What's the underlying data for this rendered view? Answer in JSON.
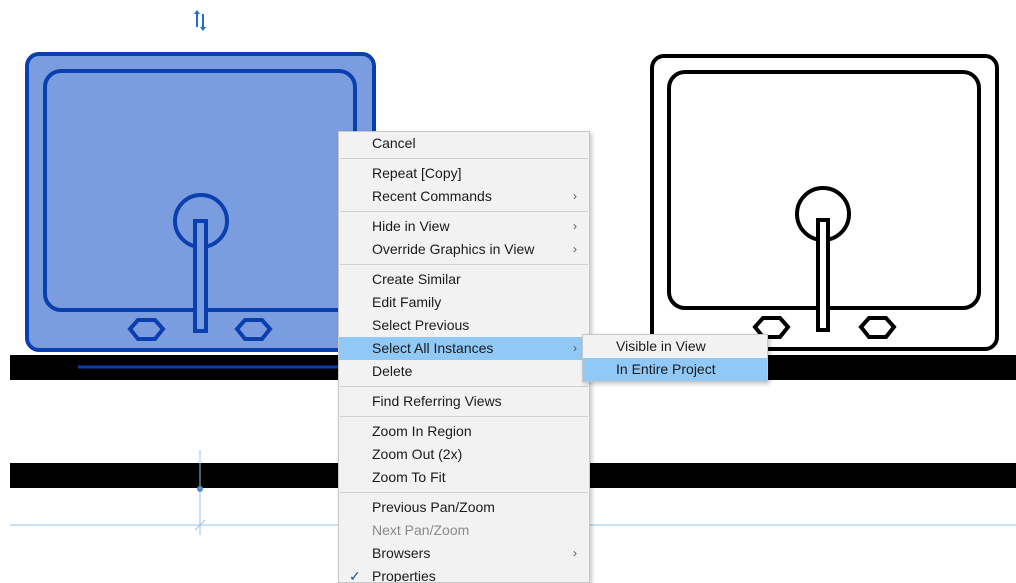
{
  "context_menu": {
    "items": [
      {
        "label": "Cancel",
        "submenu": false
      },
      {
        "separator": true
      },
      {
        "label": "Repeat [Copy]",
        "submenu": false
      },
      {
        "label": "Recent Commands",
        "submenu": true
      },
      {
        "separator": true
      },
      {
        "label": "Hide in View",
        "submenu": true
      },
      {
        "label": "Override Graphics in View",
        "submenu": true
      },
      {
        "separator": true
      },
      {
        "label": "Create Similar",
        "submenu": false
      },
      {
        "label": "Edit Family",
        "submenu": false
      },
      {
        "label": "Select Previous",
        "submenu": false
      },
      {
        "label": "Select All Instances",
        "submenu": true,
        "highlighted": true
      },
      {
        "label": "Delete",
        "submenu": false
      },
      {
        "separator": true
      },
      {
        "label": "Find Referring Views",
        "submenu": false
      },
      {
        "separator": true
      },
      {
        "label": "Zoom In Region",
        "submenu": false
      },
      {
        "label": "Zoom Out (2x)",
        "submenu": false
      },
      {
        "label": "Zoom To Fit",
        "submenu": false
      },
      {
        "separator": true
      },
      {
        "label": "Previous Pan/Zoom",
        "submenu": false
      },
      {
        "label": "Next Pan/Zoom",
        "submenu": false,
        "disabled": true
      },
      {
        "label": "Browsers",
        "submenu": true
      },
      {
        "label": "Properties",
        "submenu": false,
        "checked": true
      }
    ]
  },
  "submenu": {
    "items": [
      {
        "label": "Visible in View"
      },
      {
        "label": "In Entire Project",
        "highlighted": true
      }
    ]
  },
  "drawing": {
    "selected_fill": "#7b9de0",
    "selected_stroke": "#0a3fb0",
    "unselected_stroke": "#000000",
    "wall_color": "#000000",
    "reference_line_color": "#9ec3ea",
    "flip_control_icon": "flip-arrows-icon",
    "symbols": {
      "arrow": "›",
      "check": "✓"
    }
  }
}
